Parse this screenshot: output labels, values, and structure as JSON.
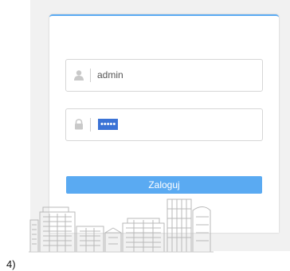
{
  "login": {
    "username_value": "admin",
    "password_masked": "•••••",
    "button_label": "Zaloguj"
  },
  "step_label": "4)",
  "colors": {
    "accent": "#5aaaf2",
    "password_highlight": "#3b73d6",
    "background": "#f1f1f1"
  },
  "icons": {
    "username": "user-icon",
    "password": "lock-icon"
  }
}
